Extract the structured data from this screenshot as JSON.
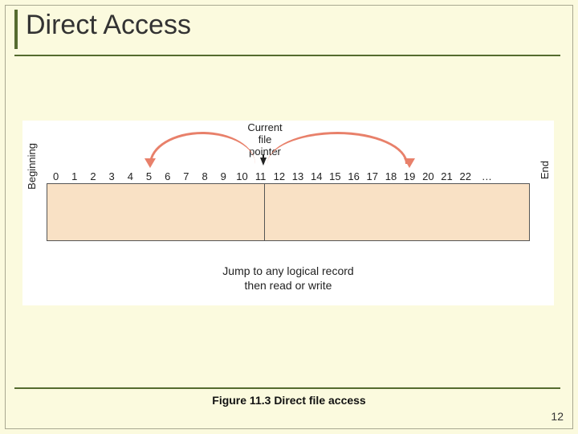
{
  "title": "Direct Access",
  "figure": {
    "pointer_label_line1": "Current",
    "pointer_label_line2": "file",
    "pointer_label_line3": "pointer",
    "begin_label": "Beginning",
    "end_label": "End",
    "ticks": [
      "0",
      "1",
      "2",
      "3",
      "4",
      "5",
      "6",
      "7",
      "8",
      "9",
      "10",
      "11",
      "12",
      "13",
      "14",
      "15",
      "16",
      "17",
      "18",
      "19",
      "20",
      "21",
      "22",
      "…"
    ],
    "bottom_line1": "Jump to any logical record",
    "bottom_line2": "then read or write"
  },
  "caption": {
    "fig_label": "Figure 11.3",
    "fig_text": "Direct file access"
  },
  "page_number": "12"
}
